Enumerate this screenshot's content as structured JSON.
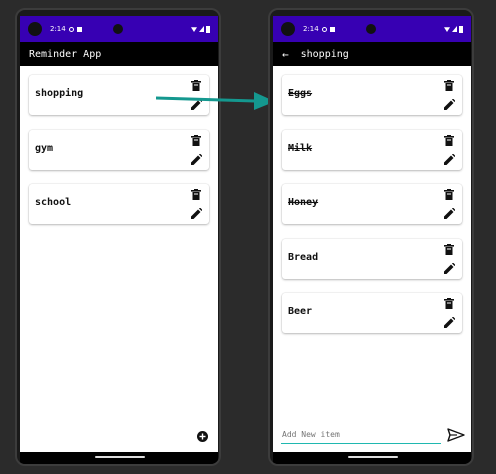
{
  "status": {
    "time": "2:14",
    "icon_names": [
      "settings-icon",
      "sim-icon",
      "wifi-icon",
      "signal-icon",
      "battery-icon"
    ]
  },
  "left_screen": {
    "title": "Reminder App",
    "items": [
      {
        "label": "shopping"
      },
      {
        "label": "gym"
      },
      {
        "label": "school"
      }
    ]
  },
  "right_screen": {
    "title": "shopping",
    "items": [
      {
        "label": "Eggs",
        "done": true
      },
      {
        "label": "Milk",
        "done": true
      },
      {
        "label": "Honey",
        "done": true
      },
      {
        "label": "Bread",
        "done": false
      },
      {
        "label": "Beer",
        "done": false
      }
    ],
    "input_placeholder": "Add New item"
  },
  "colors": {
    "status_bar": "#3700b3",
    "app_bar": "#000000",
    "accent": "#1fb8b0",
    "arrow": "#14988f"
  }
}
